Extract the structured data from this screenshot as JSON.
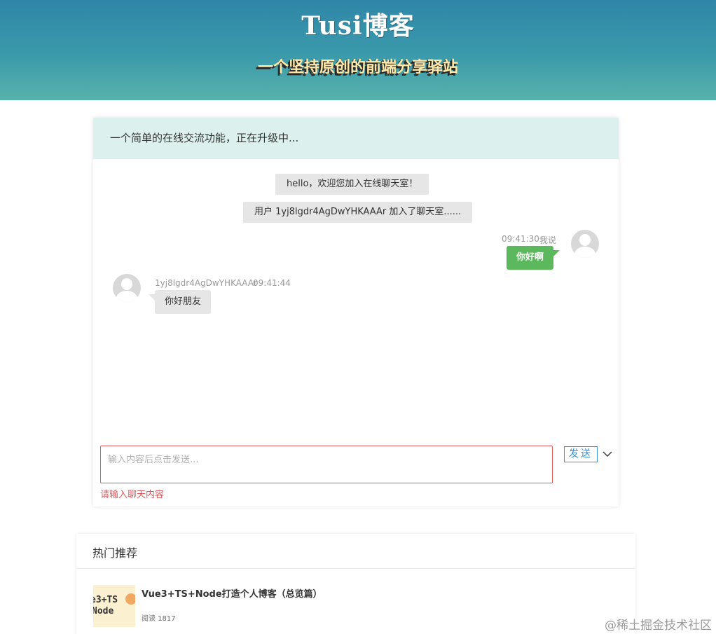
{
  "header": {
    "logo": "Tusi博客",
    "tagline": "一个坚持原创的前端分享驿站"
  },
  "chat": {
    "notice": "一个简单的在线交流功能，正在升级中...",
    "system_messages": [
      "hello，欢迎您加入在线聊天室！",
      "用户 1yj8lgdr4AgDwYHKAAAr 加入了聊天室......"
    ],
    "my_message": {
      "time": "09:41:30",
      "author": "我说",
      "text": "你好啊"
    },
    "other_message": {
      "author": "1yj8lgdr4AgDwYHKAAAr",
      "time": "09:41:44",
      "text": "你好朋友"
    },
    "input": {
      "value": "",
      "placeholder": "输入内容后点击发送..."
    },
    "error": "请输入聊天内容",
    "send_label": "发送",
    "expand_icon": "chevron-down-icon"
  },
  "recommend": {
    "title": "热门推荐",
    "items": [
      {
        "thumb_line1": "e3+TS",
        "thumb_line2": "Node",
        "title": "Vue3+TS+Node打造个人博客（总览篇）",
        "views": "阅读 1817"
      }
    ]
  },
  "watermark": "@稀土掘金技术社区",
  "colors": {
    "header_top": "#2f86a8",
    "header_bottom": "#57b2ab",
    "notice_bg": "#dcf0ed",
    "my_bubble": "#5cb85c",
    "error": "#e0585c",
    "send_button": "#3a8fd0"
  }
}
